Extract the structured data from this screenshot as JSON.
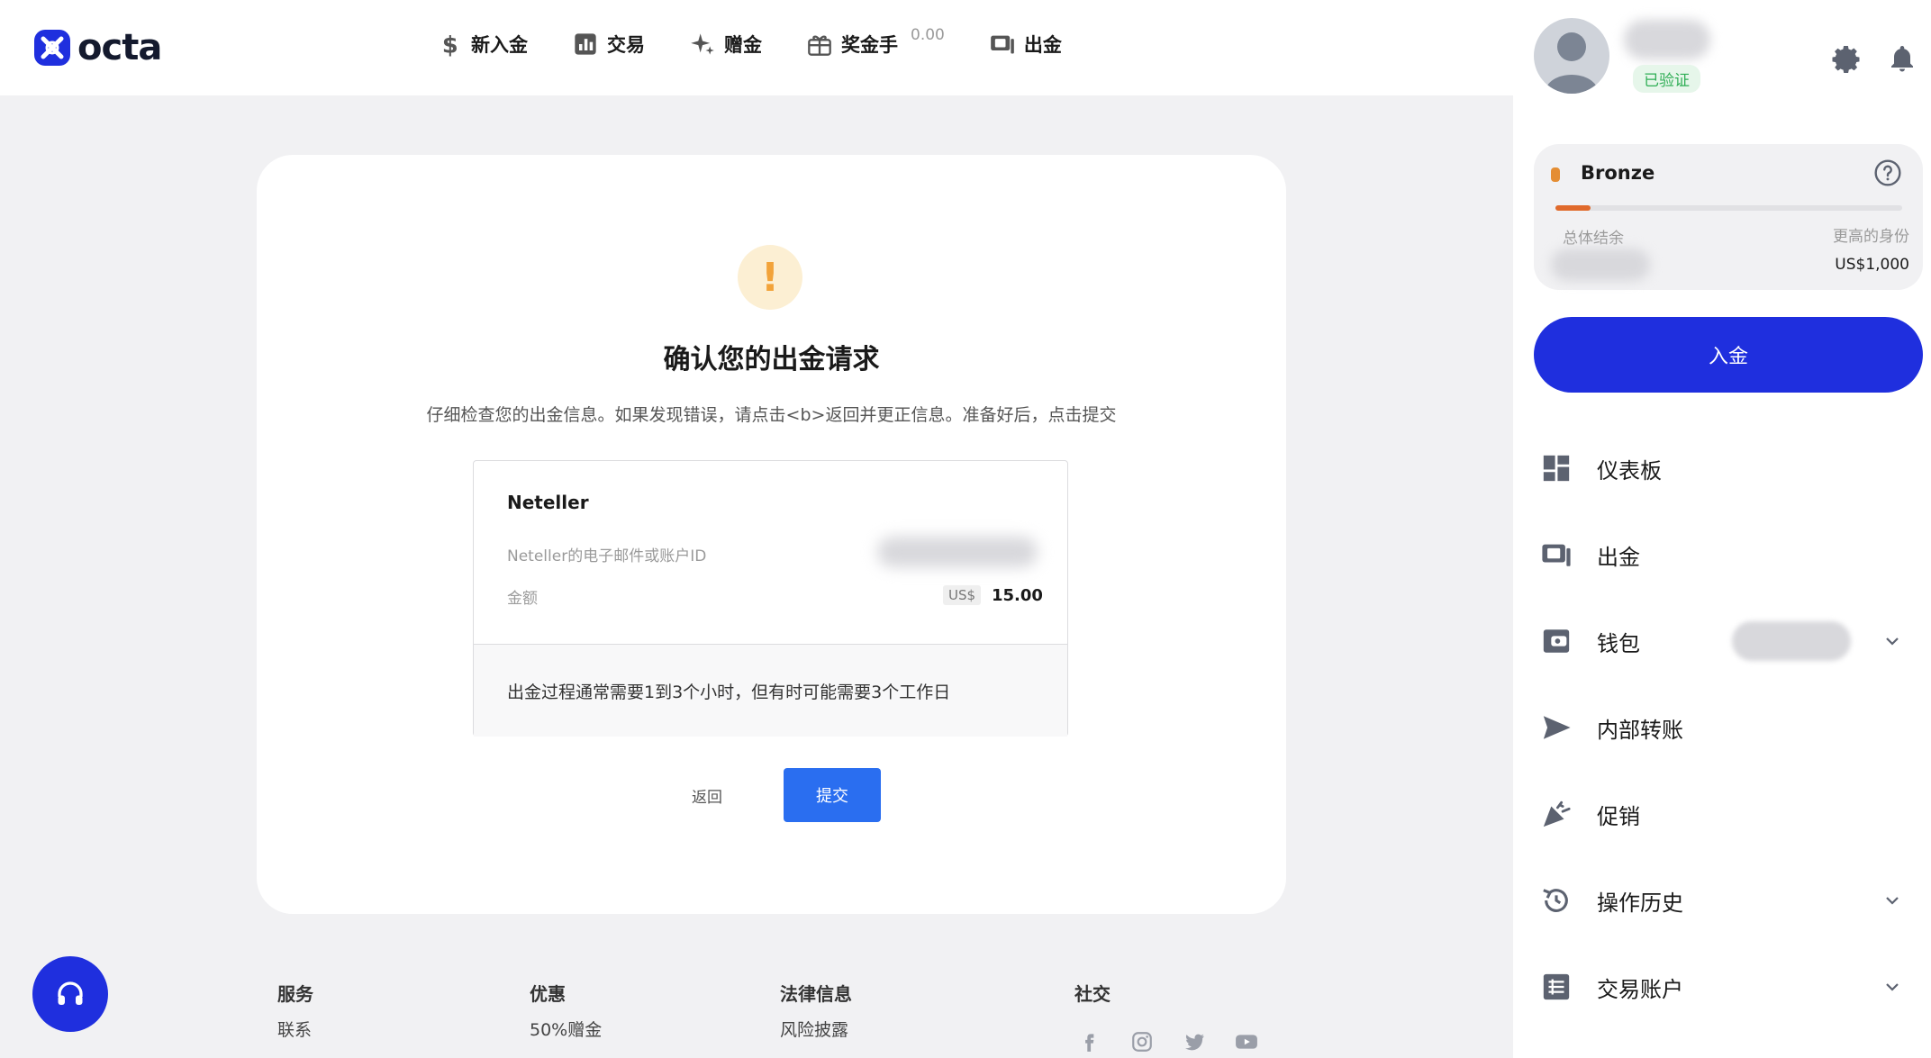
{
  "brand": {
    "name": "octa",
    "color": "#1f2fde"
  },
  "topnav": {
    "items": [
      {
        "label": "新入金",
        "icon": "dollar-icon"
      },
      {
        "label": "交易",
        "icon": "chart-icon"
      },
      {
        "label": "赠金",
        "icon": "sparkle-icon"
      },
      {
        "label": "奖金手",
        "icon": "gift-icon",
        "badge": "0.00"
      },
      {
        "label": "出金",
        "icon": "withdraw-icon"
      }
    ]
  },
  "profile": {
    "verified_label": "已验证"
  },
  "status_card": {
    "level": "Bronze",
    "total_balance_label": "总体结余",
    "next_level_label": "更高的身份",
    "next_level_amount": "US$1,000",
    "progress": 0.1
  },
  "deposit_button": "入金",
  "sidebar": {
    "items": [
      {
        "label": "仪表板",
        "icon": "dashboard-icon"
      },
      {
        "label": "出金",
        "icon": "withdraw-icon"
      },
      {
        "label": "钱包",
        "icon": "wallet-icon"
      },
      {
        "label": "内部转账",
        "icon": "send-icon"
      },
      {
        "label": "促销",
        "icon": "party-icon"
      },
      {
        "label": "操作历史",
        "icon": "history-icon"
      },
      {
        "label": "交易账户",
        "icon": "accounts-icon"
      }
    ]
  },
  "confirm": {
    "title": "确认您的出金请求",
    "subtitle": "仔细检查您的出金信息。如果发现错误，请点击<b>返回并更正信息。准备好后，点击提交",
    "method": "Neteller",
    "id_label": "Neteller的电子邮件或账户ID",
    "amount_label": "金额",
    "currency": "US$",
    "amount": "15.00",
    "note": "出金过程通常需要1到3个小时，但有时可能需要3个工作日",
    "back_label": "返回",
    "submit_label": "提交"
  },
  "footer": {
    "columns": [
      {
        "title": "服务",
        "link": "联系"
      },
      {
        "title": "优惠",
        "link": "50%赠金"
      },
      {
        "title": "法律信息",
        "link": "风险披露"
      },
      {
        "title": "社交"
      }
    ],
    "social": [
      "facebook-icon",
      "instagram-icon",
      "twitter-icon",
      "youtube-icon"
    ]
  }
}
